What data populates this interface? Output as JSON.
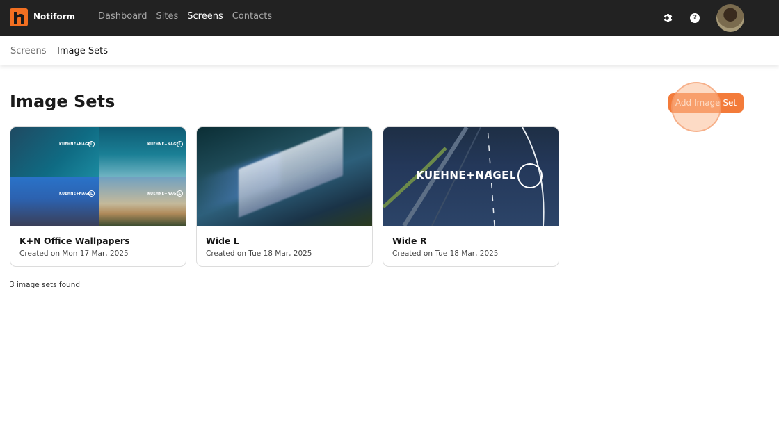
{
  "app": {
    "brand": "Notiform",
    "nav": [
      "Dashboard",
      "Sites",
      "Screens",
      "Contacts"
    ],
    "nav_active": "Screens",
    "help_glyph": "?"
  },
  "subnav": {
    "items": [
      "Screens",
      "Image Sets"
    ],
    "active": "Image Sets"
  },
  "page": {
    "title": "Image Sets",
    "add_button": "Add Image Set",
    "result_count": "3 image sets found"
  },
  "cards": [
    {
      "title": "K+N Office Wallpapers",
      "date": "Created on Mon 17 Mar, 2025",
      "thumb_logo": "KUEHNE+NAGEL"
    },
    {
      "title": "Wide L",
      "date": "Created on Tue 18 Mar, 2025"
    },
    {
      "title": "Wide R",
      "date": "Created on Tue 18 Mar, 2025",
      "thumb_logo": "KUEHNE+NAGEL"
    }
  ],
  "colors": {
    "topbar": "#222222",
    "accent": "#f26f21",
    "button": "#f37b3a"
  },
  "icons": [
    "notiform-logo-icon",
    "gear-icon",
    "help-icon",
    "avatar"
  ]
}
